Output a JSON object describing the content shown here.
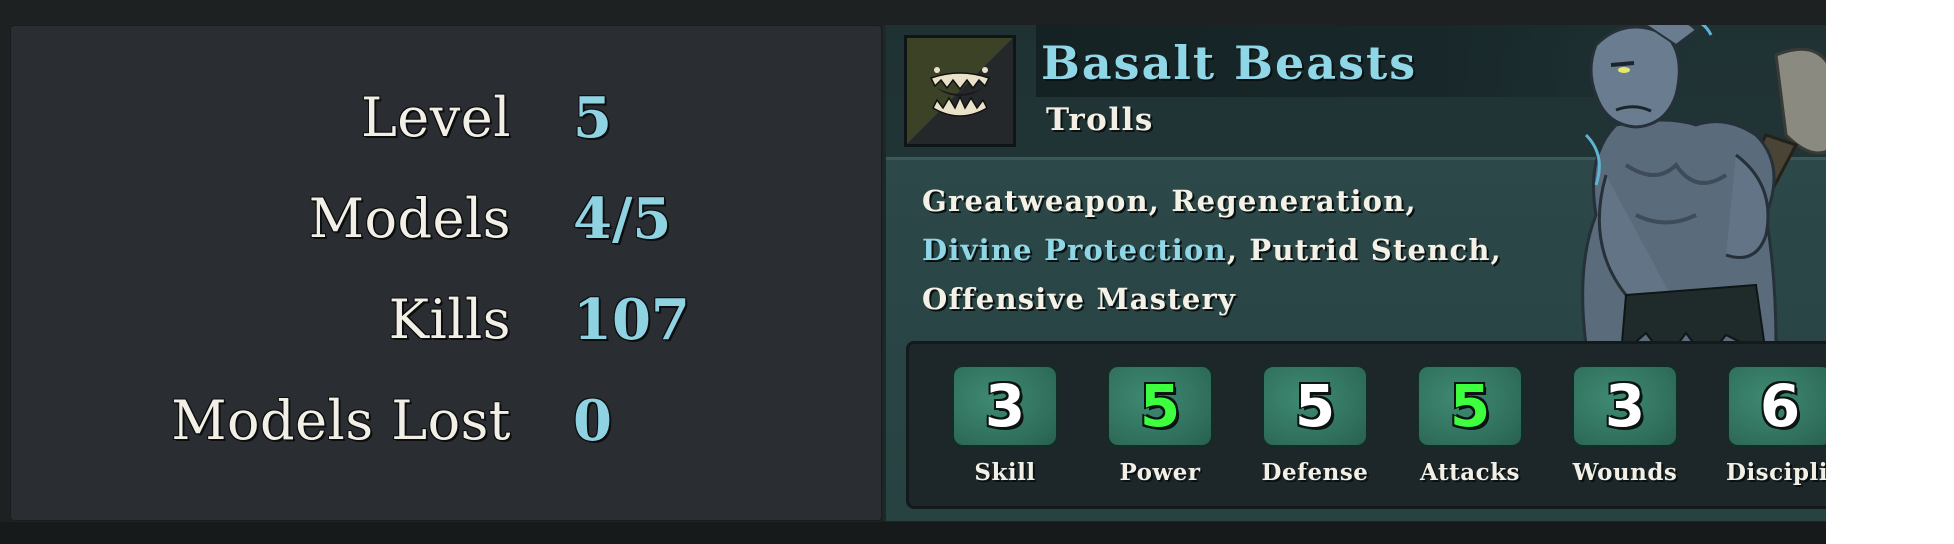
{
  "stats": [
    {
      "label": "Level",
      "value": "5"
    },
    {
      "label": "Models",
      "value": "4/5"
    },
    {
      "label": "Kills",
      "value": "107"
    },
    {
      "label": "Models Lost",
      "value": "0"
    }
  ],
  "unit": {
    "name": "Basalt Beasts",
    "race": "Trolls",
    "emblem_icon": "monster-teeth-icon",
    "portrait_icon": "troll-portrait-icon",
    "traits": {
      "line1": "Greatweapon, Regeneration,",
      "line2_highlight": "Divine Protection",
      "line2_rest": ", Putrid Stench,",
      "line3": "Offensive Mastery"
    },
    "attributes": [
      {
        "name": "Skill",
        "value": "3",
        "color": "#ffffff"
      },
      {
        "name": "Power",
        "value": "5",
        "color": "#3dff3d"
      },
      {
        "name": "Defense",
        "value": "5",
        "color": "#ffffff"
      },
      {
        "name": "Attacks",
        "value": "5",
        "color": "#3dff3d"
      },
      {
        "name": "Wounds",
        "value": "3",
        "color": "#ffffff"
      },
      {
        "name": "Disciplin",
        "value": "6",
        "color": "#ffffff"
      }
    ]
  },
  "colors": {
    "accent": "#8fd7e6",
    "buffed_stat": "#3dff3d",
    "panel_bg": "#2a2d31",
    "card_bg": "#2f4b4b"
  }
}
